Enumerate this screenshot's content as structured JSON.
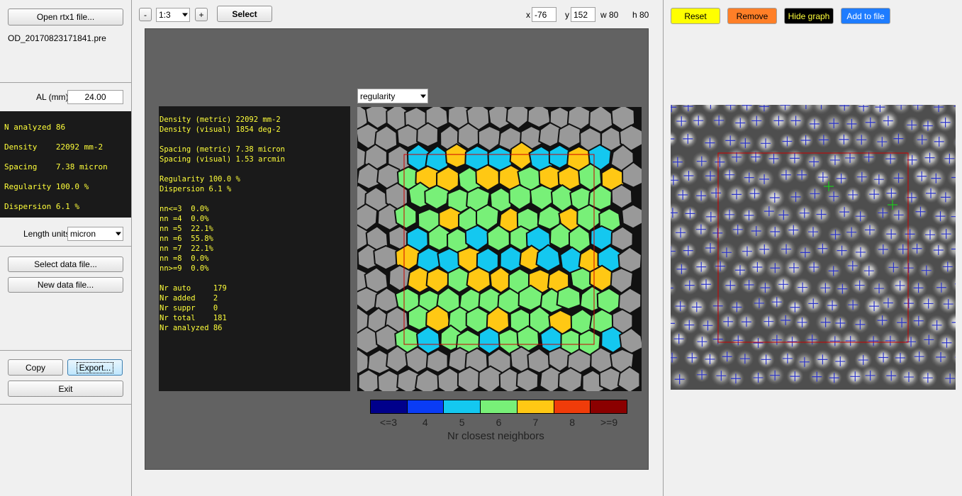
{
  "left_panel": {
    "open_button": "Open rtx1 file...",
    "filename": "OD_20170823171841.pre",
    "al_label": "AL (mm)",
    "al_value": "24.00",
    "stats": [
      {
        "label": "N analyzed",
        "value": "86"
      },
      {
        "label": "Density",
        "value": "22092 mm-2"
      },
      {
        "label": "Spacing",
        "value": "7.38 micron"
      },
      {
        "label": "Regularity",
        "value": "100.0 %"
      },
      {
        "label": "Dispersion",
        "value": "6.1 %"
      }
    ],
    "length_units_label": "Length units",
    "length_units_value": "micron",
    "select_data_button": "Select data file...",
    "new_data_button": "New data file...",
    "copy_button": "Copy",
    "export_button": "Export...",
    "exit_button": "Exit"
  },
  "toolbar": {
    "zoom_out": "-",
    "zoom_value": "1:3",
    "zoom_in": "+",
    "select_button": "Select",
    "x_label": "x",
    "x_value": "-76",
    "y_label": "y",
    "y_value": "152",
    "w_label": "w 80",
    "h_label": "h 80"
  },
  "center": {
    "mode_select": "regularity",
    "stats_lines": [
      "Density (metric) 22092 mm-2",
      "Density (visual) 1854 deg-2",
      "",
      "Spacing (metric) 7.38 micron",
      "Spacing (visual) 1.53 arcmin",
      "",
      "Regularity 100.0 %",
      "Dispersion 6.1 %",
      "",
      "nn<=3  0.0%",
      "nn =4  0.0%",
      "nn =5  22.1%",
      "nn =6  55.8%",
      "nn =7  22.1%",
      "nn =8  0.0%",
      "nn>=9  0.0%",
      "",
      "Nr auto     179",
      "Nr added    2",
      "Nr suppr    0",
      "Nr total    181",
      "Nr analyzed 86"
    ],
    "colorbar": {
      "colors": [
        "#00008b",
        "#0a3cf5",
        "#14c8f0",
        "#78f078",
        "#ffc814",
        "#f03c0a",
        "#8b0000"
      ],
      "labels": [
        "<=3",
        "4",
        "5",
        "6",
        "7",
        "8",
        ">=9"
      ],
      "title": "Nr closest neighbors"
    },
    "cell_colors": {
      "outside": "#999999",
      "5": "#14c8f0",
      "6": "#78f078",
      "7": "#ffc814"
    }
  },
  "right_panel": {
    "reset_button": "Reset",
    "remove_button": "Remove",
    "hide_graph_button": "Hide graph",
    "add_to_file_button": "Add to file",
    "colors": {
      "reset": "#ffff00",
      "remove": "#ff7f27",
      "hide_graph": "#000000",
      "add_to_file": "#1e7cff"
    }
  }
}
